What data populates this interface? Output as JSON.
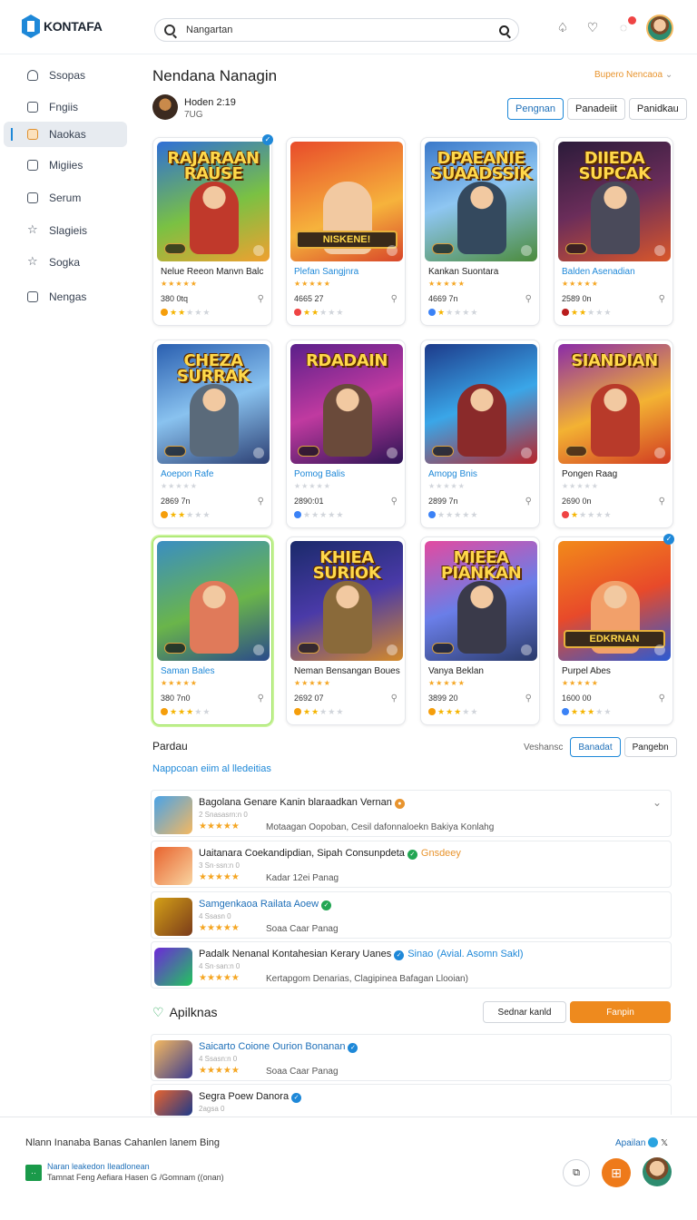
{
  "app": {
    "logo_text": "KONTAFA"
  },
  "search": {
    "value": "Nangartan"
  },
  "sidebar": {
    "items": [
      {
        "label": "Ssopas"
      },
      {
        "label": "Fngiis"
      },
      {
        "label": "Naokas"
      },
      {
        "label": "Migiies"
      },
      {
        "label": "Serum"
      },
      {
        "label": "Slagieis"
      },
      {
        "label": "Sogka"
      },
      {
        "label": "Nengas"
      }
    ]
  },
  "header": {
    "title": "Nendana Nanagin",
    "sort_label": "Bupero Nencaoa",
    "user_name": "Hoden 2:19",
    "user_sub": "7UG",
    "tabs": [
      "Pengnan",
      "Panadeiit",
      "Panidkau"
    ]
  },
  "games": [
    {
      "title_art": "RAJARAAN RAUSE",
      "name": "Nelue Reeon Manvn Balc",
      "price": "380 0tq",
      "rating": 2,
      "accent": "#f59e0b"
    },
    {
      "title_art": "",
      "sub_art": "NISKENE!",
      "name": "Plefan Sangjnra",
      "price": "4665 27",
      "rating": 2,
      "accent": "#ef4444"
    },
    {
      "title_art": "DPAEANIE SUAADSSIK",
      "name": "Kankan Suontara",
      "price": "4669 7n",
      "rating": 1,
      "accent": "#3b82f6"
    },
    {
      "title_art": "DIIEDA SUPCAK",
      "name": "Balden Asenadian",
      "price": "2589 0n",
      "rating": 2,
      "accent": "#b91c1c"
    },
    {
      "title_art": "CHEZA SURRAK",
      "name": "Aoepon Rafe",
      "price": "2869 7n",
      "rating": 2,
      "accent": "#f59e0b"
    },
    {
      "title_art": "RDADAIN",
      "name": "Pomog Balis",
      "price": "2890:01",
      "rating": 0,
      "accent": "#3b82f6"
    },
    {
      "title_art": "",
      "name": "Amopg Bnis",
      "price": "2899 7n",
      "rating": 0,
      "accent": "#3b82f6"
    },
    {
      "title_art": "SIANDIAN",
      "name": "Pongen Raag",
      "price": "2690 0n",
      "rating": 1,
      "accent": "#ef4444"
    },
    {
      "title_art": "",
      "name": "Saman Bales",
      "price": "380 7n0",
      "rating": 3,
      "accent": "#f59e0b"
    },
    {
      "title_art": "KHIEA SURIOK",
      "name": "Neman Bensangan Boues",
      "price": "2692 07",
      "rating": 2,
      "accent": "#f59e0b"
    },
    {
      "title_art": "MIEEA PIANKAN",
      "name": "Vanya Beklan",
      "price": "3899 20",
      "rating": 3,
      "accent": "#f59e0b"
    },
    {
      "title_art": "",
      "sub_art": "EDKRNAN",
      "name": "Purpel Abes",
      "price": "1600 00",
      "rating": 3,
      "accent": "#3b82f6"
    }
  ],
  "section1": {
    "title": "Pardau",
    "link": "Nappcoan eiim al lledeitias",
    "seg_plain": "Veshansc",
    "seg_sel": "Banadat",
    "seg_other": "Pangebn"
  },
  "list1": [
    {
      "title": "Bagolana Genare Kanin blaraadkan Vernan",
      "meta": "2 Snasasrn:n 0",
      "desc": "Motaagan Oopoban, Cesil dafonnaloekn Bakiya Konlahg"
    },
    {
      "title": "Uaitanara Coekandipdian, Sipah Consunpdeta",
      "tag": "Gnsdeey",
      "meta": "3 Sn·ssn:n 0",
      "desc": "Kadar 12ei Panag"
    },
    {
      "title": "Samgenkaoa Railata Aoew",
      "meta": "4 Ssasn 0",
      "desc": "Soaa Caar Panag"
    },
    {
      "title": "Padalk Nenanal Kontahesian Kerary Uanes",
      "tag": "Sinao",
      "tag2": "(Avial. Asomn Sakl)",
      "meta": "4 Sn·san:n 0",
      "desc": "Kertapgom Denarias, Clagipinea Bafagan Llooian)"
    }
  ],
  "section2": {
    "title": "Apilknas",
    "btn_outline": "Sednar kanld",
    "btn_orange": "Fanpin"
  },
  "list2": [
    {
      "title": "Saicarto Coione Ourion Bonanan",
      "meta": "4 Ssasn:n 0",
      "desc": "Soaa Caar Panag"
    },
    {
      "title": "Segra Poew Danora",
      "meta": "2agsa 0"
    }
  ],
  "footer": {
    "line1": "Nlann Inanaba Banas Cahanlen lanem Bing",
    "right": "Apailan",
    "l2": "Naran leakedon Ileadlonean",
    "l3": "Tamnat Feng Aefiara Hasen G /Gomnam ((onan)"
  }
}
